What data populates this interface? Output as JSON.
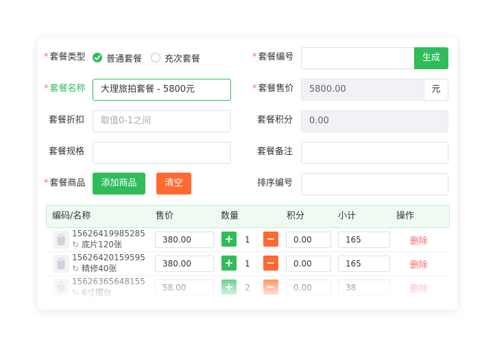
{
  "form": {
    "package_type": {
      "label": "套餐类型",
      "required": "*",
      "options": [
        "普通套餐",
        "充次套餐"
      ],
      "selected": 0
    },
    "package_code": {
      "label": "套餐编号",
      "required": "*",
      "value": "",
      "generate_label": "生成"
    },
    "package_name": {
      "label": "套餐名称",
      "required": "*",
      "value": "大理旅拍套餐 - 5800元"
    },
    "package_price": {
      "label": "套餐售价",
      "required": "*",
      "value": "5800.00",
      "unit": "元"
    },
    "package_discount": {
      "label": "套餐折扣",
      "placeholder": "取值0-1之间"
    },
    "package_points": {
      "label": "套餐积分",
      "value": "0.00"
    },
    "package_spec": {
      "label": "套餐规格",
      "value": ""
    },
    "package_note": {
      "label": "套餐备注",
      "value": ""
    },
    "package_goods": {
      "label": "套餐商品",
      "required": "*",
      "add_label": "添加商品",
      "clear_label": "清空"
    },
    "sort_code": {
      "label": "排序编号",
      "value": ""
    }
  },
  "table": {
    "headers": [
      "编码/名称",
      "售价",
      "数量",
      "积分",
      "小计",
      "操作"
    ],
    "rows": [
      {
        "code": "15626419985285",
        "name": "底片120张",
        "price": "380.00",
        "qty": "1",
        "points": "0.00",
        "subtotal": "165",
        "action": "删除"
      },
      {
        "code": "15626420159595",
        "name": "精修40张",
        "price": "380.00",
        "qty": "1",
        "points": "0.00",
        "subtotal": "165",
        "action": "删除"
      },
      {
        "code": "15626365648155",
        "name": "6寸摆台",
        "price": "58.00",
        "qty": "2",
        "points": "0.00",
        "subtotal": "38",
        "action": "删除"
      }
    ],
    "plus_symbol": "+",
    "minus_symbol": "−",
    "refresh_symbol": "↻"
  },
  "colors": {
    "primary": "#2ebd59",
    "danger": "#ff6a32",
    "required": "#f56c6c"
  }
}
